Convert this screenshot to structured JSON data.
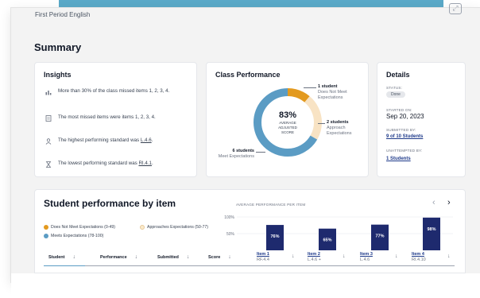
{
  "header": {
    "class_name": "First Period English"
  },
  "summary": {
    "title": "Summary"
  },
  "insights": {
    "title": "Insights",
    "items": [
      {
        "icon": "bar-chart-icon",
        "text": "More than 30% of the class missed items 1, 2, 3, 4."
      },
      {
        "icon": "document-icon",
        "text": "The most missed items were items 1, 2, 3, 4."
      },
      {
        "icon": "person-icon",
        "text_before": "The highest performing standard was ",
        "standard": "L.4.6",
        "text_after": "."
      },
      {
        "icon": "hourglass-icon",
        "text_before": "The lowest performing standard was ",
        "standard": "RI.4.1",
        "text_after": "."
      }
    ]
  },
  "class_performance": {
    "title": "Class Performance",
    "percent": "83%",
    "center_label": "AVERAGE ADJUSTED SCORE",
    "segments": [
      {
        "count": "1 student",
        "label": "Does Not Meet Expectations",
        "value": 1,
        "color": "#e39a1f"
      },
      {
        "count": "2 students",
        "label": "Approach Expectations",
        "value": 2,
        "color": "#f8e3c4"
      },
      {
        "count": "6 students",
        "label": "Meet Expectations",
        "value": 6,
        "color": "#5b9cc4"
      }
    ]
  },
  "details": {
    "title": "Details",
    "status_label": "STATUS:",
    "status": "Done",
    "started_label": "STARTED ON:",
    "started": "Sep 20, 2023",
    "submitted_label": "SUBMITTED BY:",
    "submitted": "9 of 10 Students",
    "unattempted_label": "UNATTEMPTED BY:",
    "unattempted": "1 Students"
  },
  "student_performance": {
    "title": "Student performance by item",
    "legend": [
      {
        "label": "Does Not Meet Expectations (0-49)",
        "color": "#e39a1f"
      },
      {
        "label": "Approaches Expectations (50-77)",
        "color": "#fbeacb"
      },
      {
        "label": "Meets Expectations (78-100)",
        "color": "#5b9cc4"
      }
    ],
    "columns": [
      "Student",
      "Performance",
      "Submitted",
      "Score"
    ],
    "chart_title": "AVERAGE PERFORMANCE PER ITEM",
    "items": [
      {
        "name": "Item 1",
        "standard": "RF.4.4"
      },
      {
        "name": "Item 2",
        "standard": "L.4.6 +"
      },
      {
        "name": "Item 3",
        "standard": "L.4.6"
      },
      {
        "name": "Item 4",
        "standard": "RI.4.10"
      }
    ]
  },
  "chart_data": {
    "type": "bar",
    "title": "AVERAGE PERFORMANCE PER ITEM",
    "categories": [
      "Item 1",
      "Item 2",
      "Item 3",
      "Item 4"
    ],
    "values": [
      76,
      65,
      77,
      98
    ],
    "value_labels": [
      "76%",
      "65%",
      "77%",
      "98%"
    ],
    "y_ticks": [
      "100%",
      "50%"
    ],
    "ylim": [
      0,
      100
    ],
    "bar_color": "#1e2a6e"
  }
}
